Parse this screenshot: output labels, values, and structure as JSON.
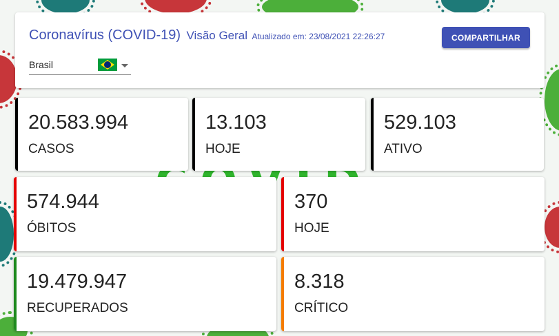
{
  "header": {
    "title": "Coronavírus (COVID-19)",
    "subtitle": "Visão Geral",
    "updated": "Atualizado em: 23/08/2021 22:26:27",
    "share_label": "COMPARTILHAR",
    "country": "Brasil",
    "flag_icon": "brazil-flag-icon"
  },
  "stats": {
    "cases": {
      "value": "20.583.994",
      "label": "CASOS",
      "color": "#000000"
    },
    "today_cases": {
      "value": "13.103",
      "label": "HOJE",
      "color": "#000000"
    },
    "active": {
      "value": "529.103",
      "label": "ATIVO",
      "color": "#000000"
    },
    "deaths": {
      "value": "574.944",
      "label": "ÓBITOS",
      "color": "#e50000"
    },
    "today_deaths": {
      "value": "370",
      "label": "HOJE",
      "color": "#e50000"
    },
    "recovered": {
      "value": "19.479.947",
      "label": "RECUPERADOS",
      "color": "#1e8a1e"
    },
    "critical": {
      "value": "8.318",
      "label": "CRÍTICO",
      "color": "#f57c00"
    }
  }
}
